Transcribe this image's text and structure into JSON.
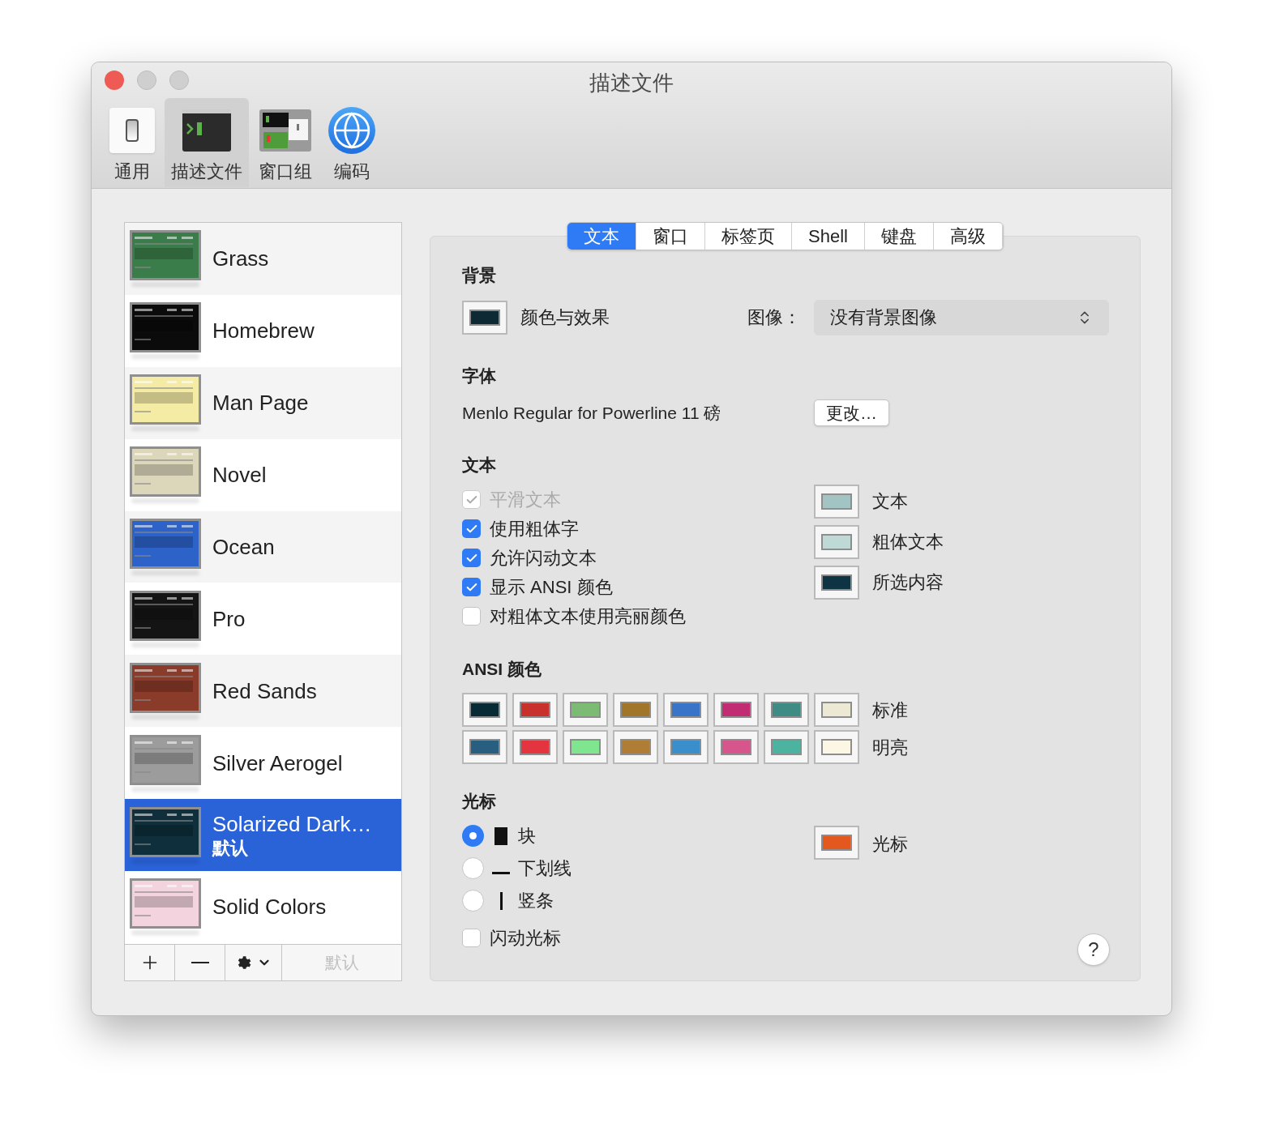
{
  "window": {
    "title": "描述文件"
  },
  "toolbar": [
    {
      "label": "通用",
      "kind": "switch",
      "selected": false
    },
    {
      "label": "描述文件",
      "kind": "terminal",
      "selected": true
    },
    {
      "label": "窗口组",
      "kind": "windows",
      "selected": false
    },
    {
      "label": "编码",
      "kind": "globe",
      "selected": false
    }
  ],
  "profiles": [
    {
      "name": "Grass",
      "color": "#3b7d4a",
      "selected": false
    },
    {
      "name": "Homebrew",
      "color": "#0b0b0b",
      "selected": false
    },
    {
      "name": "Man Page",
      "color": "#f4eca5",
      "selected": false
    },
    {
      "name": "Novel",
      "color": "#dcd6bb",
      "selected": false
    },
    {
      "name": "Ocean",
      "color": "#2d62c8",
      "selected": false
    },
    {
      "name": "Pro",
      "color": "#141414",
      "selected": false
    },
    {
      "name": "Red Sands",
      "color": "#8a3b2a",
      "selected": false
    },
    {
      "name": "Silver Aerogel",
      "color": "#9c9c9c",
      "selected": false
    },
    {
      "name": "Solarized Dark…",
      "subtitle": "默认",
      "color": "#0e2f3b",
      "selected": true
    },
    {
      "name": "Solid Colors",
      "color": "#f3d3dd",
      "selected": false
    }
  ],
  "list_toolbar": {
    "default_button": {
      "label": "默认",
      "disabled": true
    }
  },
  "tabs": [
    {
      "label": "文本",
      "selected": true
    },
    {
      "label": "窗口",
      "selected": false
    },
    {
      "label": "标签页",
      "selected": false
    },
    {
      "label": "Shell",
      "selected": false
    },
    {
      "label": "键盘",
      "selected": false
    },
    {
      "label": "高级",
      "selected": false
    }
  ],
  "background": {
    "heading": "背景",
    "color": "#0d2a34",
    "label": "颜色与效果",
    "image_label": "图像：",
    "image_value": "没有背景图像"
  },
  "font": {
    "heading": "字体",
    "value": "Menlo Regular for Powerline 11 磅",
    "button": "更改…"
  },
  "text": {
    "heading": "文本",
    "options": [
      {
        "label": "平滑文本",
        "checked": true,
        "disabled": true
      },
      {
        "label": "使用粗体字",
        "checked": true,
        "disabled": false
      },
      {
        "label": "允许闪动文本",
        "checked": true,
        "disabled": false
      },
      {
        "label": "显示 ANSI 颜色",
        "checked": true,
        "disabled": false
      },
      {
        "label": "对粗体文本使用亮丽颜色",
        "checked": false,
        "disabled": false
      }
    ],
    "colors": [
      {
        "label": "文本",
        "color": "#a2c5c4"
      },
      {
        "label": "粗体文本",
        "color": "#bfdad6"
      },
      {
        "label": "所选内容",
        "color": "#0e3444"
      }
    ]
  },
  "ansi": {
    "heading": "ANSI 颜色",
    "rows": [
      {
        "label": "标准",
        "colors": [
          {
            "color": "#082b36"
          },
          {
            "color": "#c8312c"
          },
          {
            "color": "#7cbb73"
          },
          {
            "color": "#a2762a"
          },
          {
            "color": "#3874c8"
          },
          {
            "color": "#c22c72"
          },
          {
            "color": "#3e8c84"
          },
          {
            "color": "#ebe8d4"
          }
        ]
      },
      {
        "label": "明亮",
        "colors": [
          {
            "color": "#285f80"
          },
          {
            "color": "#e3343f"
          },
          {
            "color": "#80e58f"
          },
          {
            "color": "#af7e34"
          },
          {
            "color": "#3a8ecb"
          },
          {
            "color": "#d6558c"
          },
          {
            "color": "#4db3a1"
          },
          {
            "color": "#fbf7e4"
          }
        ]
      }
    ]
  },
  "cursor": {
    "heading": "光标",
    "styles": [
      {
        "kind": "block",
        "label": "块",
        "selected": true
      },
      {
        "kind": "underline",
        "label": "下划线",
        "selected": false
      },
      {
        "kind": "bar",
        "label": "竖条",
        "selected": false
      }
    ],
    "blink": {
      "label": "闪动光标",
      "checked": false
    },
    "color": {
      "label": "光标",
      "color": "#e2581f"
    }
  },
  "help": "?"
}
